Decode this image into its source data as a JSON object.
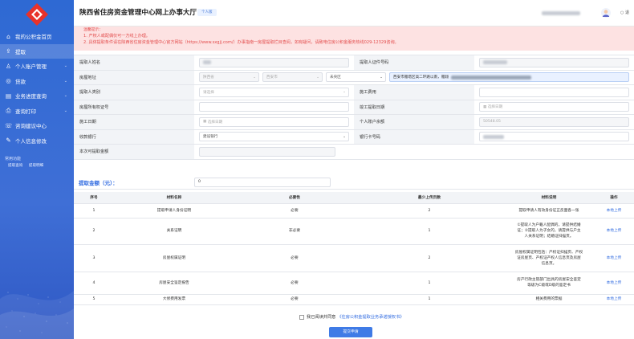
{
  "app": {
    "title": "陕西省住房资金管理中心网上办事大厅",
    "badge": "个人版",
    "top_right": "退"
  },
  "sidebar": {
    "items": [
      {
        "label": "我的公积金首页",
        "icon": "home-icon",
        "glyph": "⌂",
        "chevron": false
      },
      {
        "label": "提取",
        "icon": "withdraw-icon",
        "glyph": "⇪",
        "chevron": false
      },
      {
        "label": "个人账户管理",
        "icon": "user-icon",
        "glyph": "♙",
        "chevron": true
      },
      {
        "label": "贷款",
        "icon": "loan-icon",
        "glyph": "◎",
        "chevron": true
      },
      {
        "label": "业务进度查询",
        "icon": "progress-icon",
        "glyph": "▤",
        "chevron": true
      },
      {
        "label": "查询打印",
        "icon": "print-icon",
        "glyph": "⎙",
        "chevron": true
      },
      {
        "label": "咨询建议中心",
        "icon": "consult-icon",
        "glyph": "☏",
        "chevron": false
      },
      {
        "label": "个人信息修改",
        "icon": "edit-icon",
        "glyph": "✎",
        "chevron": false
      }
    ],
    "active_index": 1,
    "quick_title": "常用功能",
    "quick_links": [
      "提取查询",
      "提取明细"
    ]
  },
  "notice": {
    "title": "温馨提示：",
    "lines": [
      "1. 产权人或配偶仅可一方线上办理。",
      "2. 具体提取条件请在陕西省住房资金管理中心官方网站（https://www.sxgjj.com/）办事指南一房屋提取栏目查阅，如有疑问，请致电住房公积金服务热线029-12329咨询。"
    ]
  },
  "form": {
    "name_label": "提取人姓名",
    "id_label": "提取人证件号码",
    "addr_label": "房屋地址",
    "addr_province": "陕西省",
    "addr_city": "西安市",
    "addr_district": "未央区",
    "addr_detail": "西安市雁塔区高二环路以南，雁翔",
    "type_label": "提取人类别",
    "type_placeholder": "请选择",
    "fee_label": "施工费用",
    "cert_label": "房屋所有权证号",
    "complete_label": "竣工提取日期",
    "complete_placeholder": "选择日期",
    "start_label": "施工日期",
    "start_placeholder": "选择日期",
    "balance_label": "个人账户余额",
    "balance_value": "50548.05",
    "bank_label": "收款银行",
    "bank_value": "建设银行",
    "card_label": "银行卡号码",
    "amount_total_label": "本次可提取金额"
  },
  "amount": {
    "label": "提取金额（元）：",
    "value": "0"
  },
  "docs": {
    "headers": [
      "序号",
      "材料名称",
      "必要性",
      "最少上传页数",
      "材料说明",
      "操作"
    ],
    "rows": [
      {
        "no": "1",
        "name": "提取申请人身份证明",
        "req": "必要",
        "pages": "2",
        "desc": [
          "提取申请人有效身份证正反面各一张"
        ],
        "op": "本地上传"
      },
      {
        "no": "2",
        "name": "关系证明",
        "req": "非必要",
        "pages": "1",
        "desc": [
          "①提取人为户籍人配偶的，请提供结婚",
          "证；②提取人为子女的，请提供与户主",
          "人关系证明；结婚证扫描页。"
        ],
        "op": "本地上传"
      },
      {
        "no": "3",
        "name": "房屋权属证明",
        "req": "必要",
        "pages": "2",
        "desc": [
          "房屋权属证明包括：产权证扫描页、产权",
          "证房屋页、产权证产权人信息页及房屋",
          "信息页。"
        ],
        "op": "本地上传"
      },
      {
        "no": "4",
        "name": "房屋安全鉴定报告",
        "req": "必要",
        "pages": "1",
        "desc": [
          "房产行政主管部门出具的房屋安全鉴定",
          "等级为C级或D级的鉴定书"
        ],
        "op": "本地上传"
      },
      {
        "no": "5",
        "name": "大修费用发票",
        "req": "必要",
        "pages": "1",
        "desc": [
          "相关费用的票据"
        ],
        "op": "本地上传"
      }
    ]
  },
  "agree": {
    "text": "我已阅读并同意",
    "link": "《住房公积金提取业务承诺授权书》"
  },
  "submit_label": "提交申请"
}
